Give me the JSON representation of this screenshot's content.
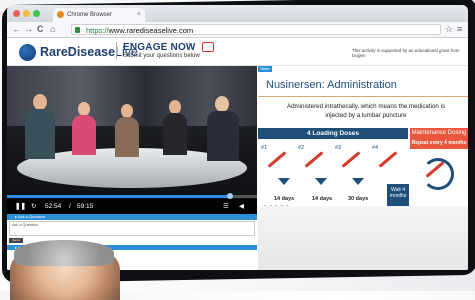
{
  "browser": {
    "tab_title": "Chrome Browser",
    "tab_close": "×",
    "url_scheme": "https://",
    "url_rest": "www.rarediseaselive.com",
    "nav": {
      "back": "←",
      "forward": "→",
      "reload": "C",
      "home": "⌂",
      "star": "☆",
      "menu": "≡"
    }
  },
  "site": {
    "logo_rare": "RareDisease",
    "logo_live": "Live",
    "engage_title": "ENGAGE NOW",
    "engage_sub": "Submit your questions below",
    "support_text": "This activity is supported by an educational grant from biogen"
  },
  "video": {
    "current_time": "52:54",
    "separator": "/",
    "total_time": "59:15",
    "progress": 0.89,
    "play_icon": "play-pause-icon"
  },
  "questions": {
    "header": "▸ Ask a Question",
    "placeholder": "Ask a Question",
    "button": "Send",
    "resources_header": "▸ Event Resources"
  },
  "slide": {
    "tag": "Slides",
    "title": "Nusinersen: Administration",
    "description": "Administered intrathecally, which means the medication is injected by a lumbar puncture",
    "loading_header": "4 Loading Doses",
    "maintenance_header": "Maintenance Dosing",
    "maintenance_sub": "Repeat every 4 months",
    "doses": [
      "#1",
      "#2",
      "#3",
      "#4"
    ],
    "intervals": [
      "14 days",
      "14 days",
      "30 days"
    ],
    "wait_label": "Wait 4 months"
  },
  "colors": {
    "accent_blue": "#2a8fd4",
    "navy": "#1f4e79",
    "coral": "#e9573f",
    "syringe_red": "#d93a2b"
  }
}
